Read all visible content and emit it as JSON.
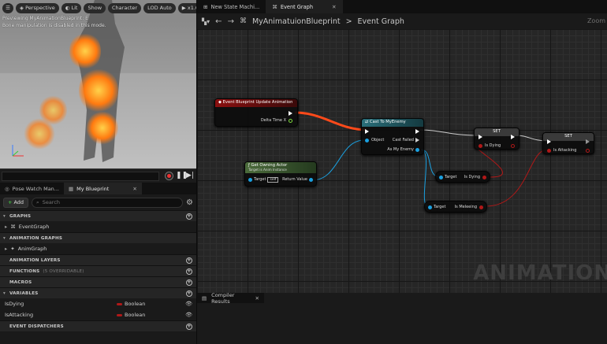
{
  "viewport": {
    "toolbar": {
      "menu_icon": "hamburger-icon",
      "perspective": "Perspective",
      "lit": "Lit",
      "show": "Show",
      "character": "Character",
      "lod": "LOD Auto",
      "speed": "x1.0"
    },
    "message_1": "Previewing MyAnimationBlueprint: E",
    "message_2": "Bone manipulation is disabled in this mode."
  },
  "left_tabs": [
    {
      "label": "Pose Watch Man..."
    },
    {
      "label": "My Blueprint"
    }
  ],
  "my_blueprint": {
    "add_label": "Add",
    "search_placeholder": "Search",
    "sections": {
      "graphs": "GRAPHS",
      "animation_graphs": "ANIMATION GRAPHS",
      "animation_layers": "ANIMATION LAYERS",
      "functions": "FUNCTIONS",
      "functions_note": "(5 OVERRIDABLE)",
      "macros": "MACROS",
      "variables": "VARIABLES",
      "event_dispatchers": "EVENT DISPATCHERS"
    },
    "graph_items": [
      "EventGraph"
    ],
    "anim_graph_items": [
      "AnimGraph"
    ],
    "variables": [
      {
        "name": "IsDying",
        "type": "Boolean"
      },
      {
        "name": "IsAttacking",
        "type": "Boolean"
      }
    ]
  },
  "graph_tabs": [
    {
      "label": "New State Machi..."
    },
    {
      "label": "Event Graph"
    }
  ],
  "breadcrumb": {
    "blueprint": "MyAnimatuionBlueprint",
    "separator": ">",
    "graph": "Event Graph"
  },
  "zoom_label": "Zoom",
  "watermark": "ANIMATION",
  "nodes": {
    "event": {
      "title": "Event Blueprint Update Animation",
      "pin_delta": "Delta Time X"
    },
    "cast": {
      "title": "Cast To MyEnemy",
      "pin_object": "Object",
      "pin_failed": "Cast Failed",
      "pin_as": "As My Enemy"
    },
    "owning": {
      "title": "Get Owning Actor",
      "subtitle": "Target is Anim Instance",
      "pin_target": "Target",
      "pin_target_value": "self",
      "pin_return": "Return Value"
    },
    "set1": {
      "title": "SET",
      "pin": "Is Dying"
    },
    "set2": {
      "title": "SET",
      "pin": "Is Attacking"
    },
    "get_dying": {
      "pin_target": "Target",
      "pin_value": "Is Dying"
    },
    "get_meleeing": {
      "pin_target": "Target",
      "pin_value": "Is Meleeing"
    }
  },
  "compiler": {
    "tab": "Compiler Results"
  },
  "colors": {
    "exec": "#ffffff",
    "object_pin": "#1aa0e0",
    "bool_pin": "#b01818",
    "event_header": "#8b1010",
    "cast_header": "#2a6f7a",
    "function_header": "#4b6b3b",
    "set_header": "#3a3a3a"
  }
}
